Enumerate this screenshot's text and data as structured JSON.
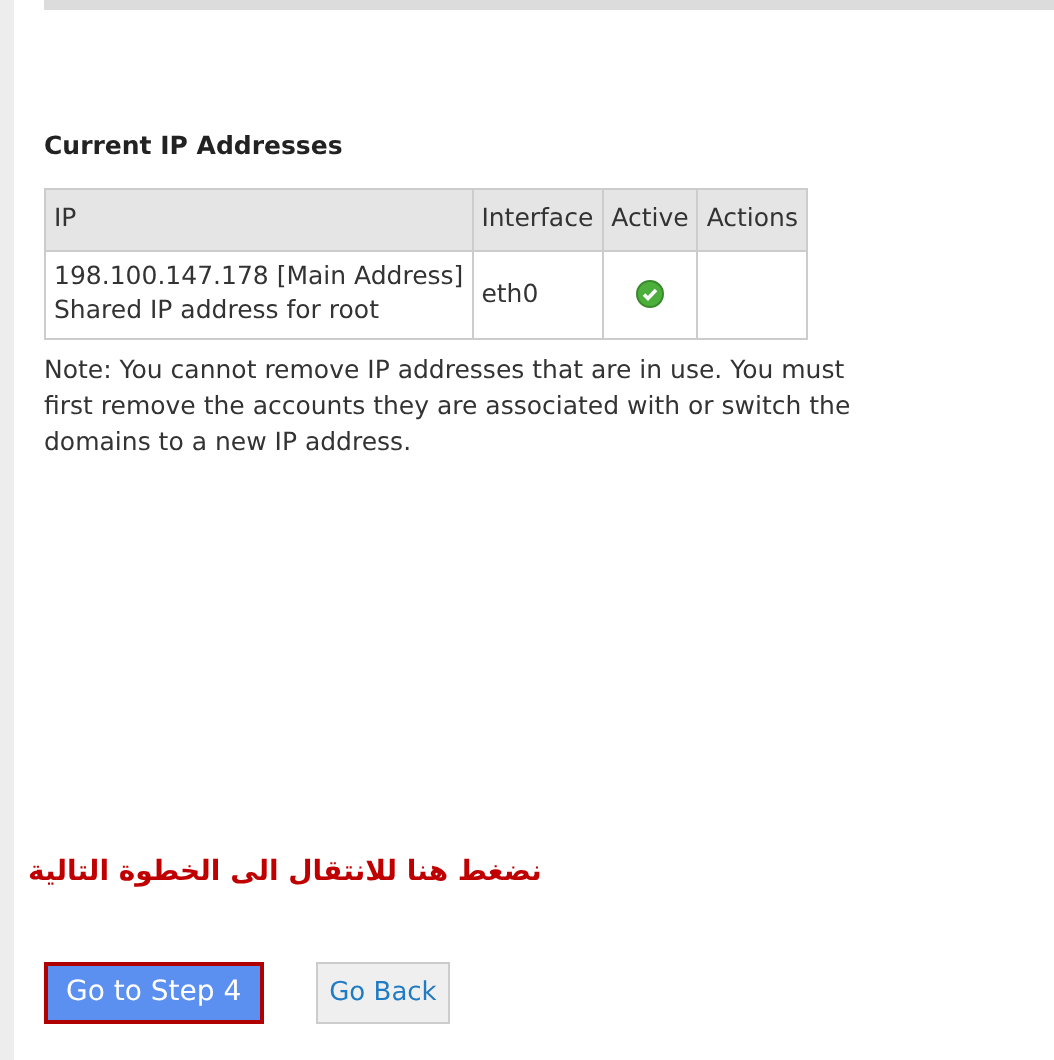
{
  "section_title": "Current IP Addresses",
  "table": {
    "columns": [
      "IP",
      "Interface",
      "Active",
      "Actions"
    ],
    "rows": [
      {
        "ip": "198.100.147.178 [Main Address]",
        "description": "Shared IP address for root",
        "interface": "eth0",
        "active": true
      }
    ]
  },
  "note": "Note: You cannot remove IP addresses that are in use. You must first remove the accounts they are associated with or switch the domains to a new IP address.",
  "annotation": "نضغط هنا للانتقال الى الخطوة التالية",
  "buttons": [
    {
      "label": "Go to Step 4",
      "kind": "primary"
    },
    {
      "label": "Go Back",
      "kind": "secondary"
    }
  ]
}
